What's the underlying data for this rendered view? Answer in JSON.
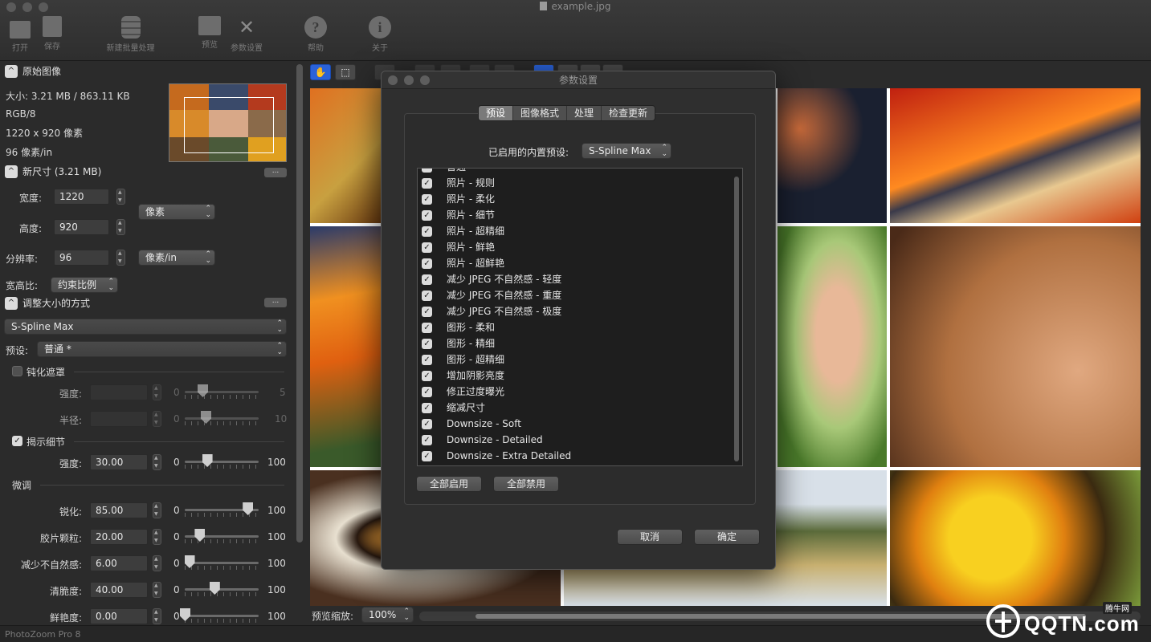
{
  "window": {
    "title": "example.jpg"
  },
  "toolbar": [
    {
      "label": "打开",
      "icon": "folder-icon"
    },
    {
      "label": "保存",
      "icon": "disk-icon"
    },
    {
      "label": "新建批量处理",
      "icon": "database-icon"
    },
    {
      "label": "预览",
      "icon": "photo-icon"
    },
    {
      "label": "参数设置",
      "icon": "wrench-icon"
    },
    {
      "label": "帮助",
      "icon": "help-icon"
    },
    {
      "label": "关于",
      "icon": "info-icon"
    }
  ],
  "original": {
    "header": "原始图像",
    "size": "大小: 3.21 MB / 863.11 KB",
    "mode": "RGB/8",
    "dimensions": "1220 x 920 像素",
    "resolution": "96 像素/in"
  },
  "new_size": {
    "header": "新尺寸 (3.21 MB)",
    "width_label": "宽度:",
    "width_value": "1220",
    "height_label": "高度:",
    "height_value": "920",
    "unit": "像素",
    "resolution_label": "分辨率:",
    "resolution_value": "96",
    "resolution_unit": "像素/in",
    "aspect_label": "宽高比:",
    "aspect_value": "约束比例"
  },
  "resize_method": {
    "header": "调整大小的方式",
    "method": "S-Spline Max",
    "preset_label": "预设:",
    "preset_value": "普通 *"
  },
  "unsharp": {
    "label": "钝化遮罩",
    "checked": false,
    "strength_label": "强度:",
    "strength_min": "0",
    "strength_max": "5",
    "radius_label": "半径:",
    "radius_min": "0",
    "radius_max": "10"
  },
  "reveal": {
    "label": "揭示细节",
    "checked": true,
    "strength_label": "强度:",
    "strength_value": "30.00",
    "min": "0",
    "max": "100",
    "level": 0.3
  },
  "fine_tune": {
    "header": "微调",
    "rows": [
      {
        "label": "锐化:",
        "value": "85.00",
        "min": "0",
        "max": "100",
        "level": 0.85
      },
      {
        "label": "胶片颗粒:",
        "value": "20.00",
        "min": "0",
        "max": "100",
        "level": 0.2
      },
      {
        "label": "减少不自然感:",
        "value": "6.00",
        "min": "0",
        "max": "100",
        "level": 0.06
      },
      {
        "label": "清脆度:",
        "value": "40.00",
        "min": "0",
        "max": "100",
        "level": 0.4
      },
      {
        "label": "鲜艳度:",
        "value": "0.00",
        "min": "0",
        "max": "100",
        "level": 0.0
      }
    ]
  },
  "preview_zoom": {
    "label": "预览缩放:",
    "value": "100%"
  },
  "status": {
    "app": "PhotoZoom Pro 8"
  },
  "dialog": {
    "title": "参数设置",
    "tabs": [
      "预设",
      "图像格式",
      "处理",
      "检查更新"
    ],
    "active_tab": "预设",
    "builtin_label": "已启用的内置预设:",
    "builtin_value": "S-Spline Max",
    "presets": [
      "普通",
      "照片 - 规则",
      "照片 - 柔化",
      "照片 - 细节",
      "照片 - 超精细",
      "照片 - 鲜艳",
      "照片 - 超鲜艳",
      "减少 JPEG 不自然感 - 轻度",
      "减少 JPEG 不自然感 - 重度",
      "减少 JPEG 不自然感 - 极度",
      "图形 - 柔和",
      "图形 - 精细",
      "图形 - 超精细",
      "增加阴影亮度",
      "修正过度曝光",
      "缩减尺寸",
      "Downsize - Soft",
      "Downsize - Detailed",
      "Downsize - Extra Detailed"
    ],
    "enable_all": "全部启用",
    "disable_all": "全部禁用",
    "cancel": "取消",
    "ok": "确定"
  },
  "watermark": {
    "brand": "QQTN.com",
    "site": "腾牛网"
  },
  "colors": {
    "accent": "#2a62d9",
    "panel": "#2b2b2b",
    "dialog": "#2f2f2f"
  }
}
